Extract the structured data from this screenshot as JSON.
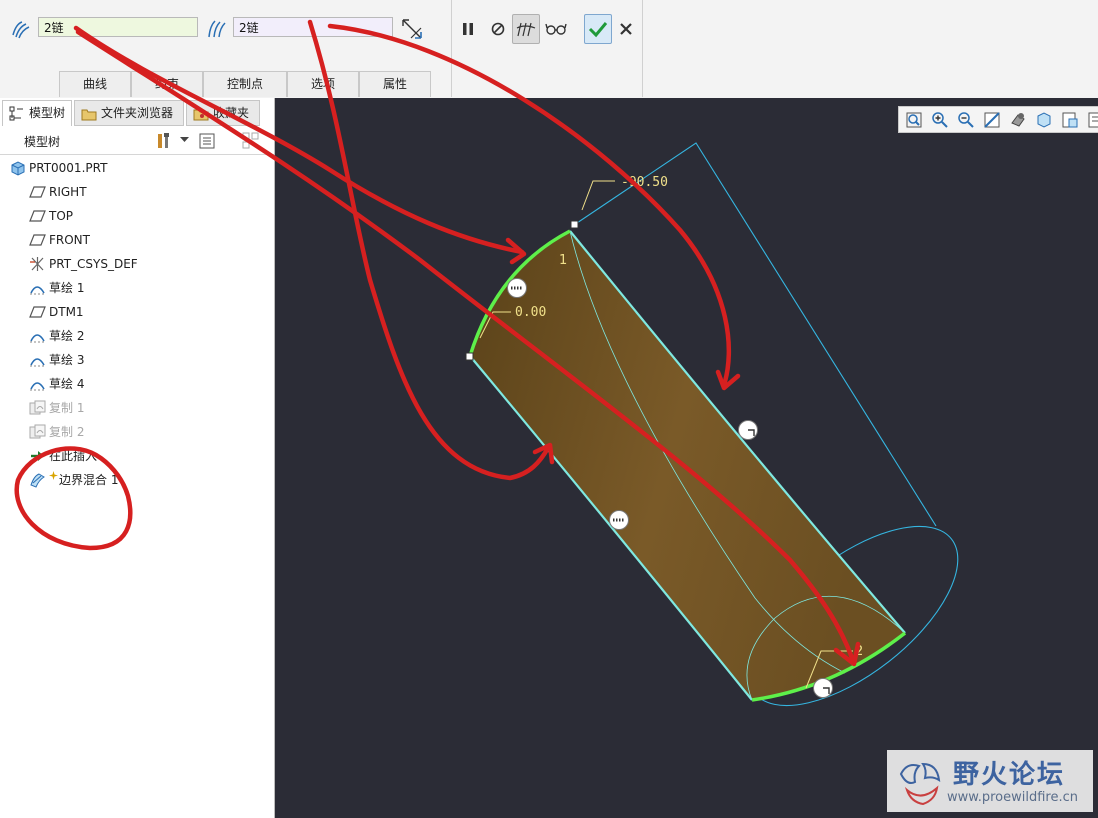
{
  "dashboard": {
    "chain1_value": "2链",
    "chain2_value": "2链",
    "tabs": [
      "曲线",
      "约束",
      "控制点",
      "选项",
      "属性"
    ]
  },
  "panel": {
    "nav_tabs": [
      "模型树",
      "文件夹浏览器",
      "收藏夹"
    ],
    "tree_title": "模型树"
  },
  "tree": {
    "items": [
      {
        "label": "PRT0001.PRT",
        "icon": "part-icon"
      },
      {
        "label": "RIGHT",
        "icon": "datum-plane-icon"
      },
      {
        "label": "TOP",
        "icon": "datum-plane-icon"
      },
      {
        "label": "FRONT",
        "icon": "datum-plane-icon"
      },
      {
        "label": "PRT_CSYS_DEF",
        "icon": "csys-icon"
      },
      {
        "label": "草绘 1",
        "icon": "sketch-icon"
      },
      {
        "label": "DTM1",
        "icon": "datum-plane-icon"
      },
      {
        "label": "草绘 2",
        "icon": "sketch-icon"
      },
      {
        "label": "草绘 3",
        "icon": "sketch-icon"
      },
      {
        "label": "草绘 4",
        "icon": "sketch-icon"
      },
      {
        "label": "复制 1",
        "icon": "copy-icon"
      },
      {
        "label": "复制 2",
        "icon": "copy-icon"
      },
      {
        "label": "在此插入",
        "icon": "insert-here-arrow-icon"
      },
      {
        "label": "边界混合 1",
        "icon": "boundary-blend-icon"
      }
    ]
  },
  "graphics": {
    "dim_angle": "-90.50",
    "dim_zero": "0.00",
    "chain_label_1": "1",
    "chain_label_2": "2"
  },
  "watermark": {
    "title": "野火论坛",
    "url": "www.proewildfire.cn"
  },
  "colors": {
    "background": "#2b2c36",
    "surface": "#6e5223",
    "boundary_chain": "#5ef04a",
    "edge": "#7fe8e0",
    "reference": "#35b5e0",
    "annotation": "#d62020",
    "dimension": "#f0e08a"
  }
}
